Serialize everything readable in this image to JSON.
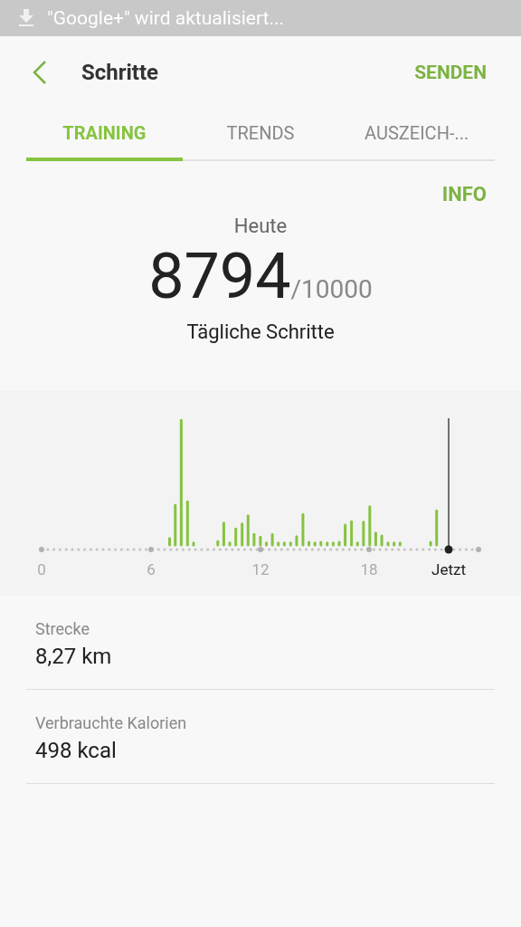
{
  "status_bar": {
    "notification": "\"Google+\" wird aktualisiert..."
  },
  "header": {
    "title": "Schritte",
    "action": "SENDEN"
  },
  "tabs": [
    {
      "label": "TRAINING",
      "selected": true
    },
    {
      "label": "TRENDS",
      "selected": false
    },
    {
      "label": "AUSZEICH-...",
      "selected": false
    }
  ],
  "info_link": "INFO",
  "summary": {
    "day_label": "Heute",
    "steps": "8794",
    "goal": "/10000",
    "caption": "Tägliche Schritte"
  },
  "chart": {
    "axis_labels": [
      "0",
      "6",
      "12",
      "18"
    ],
    "now_label": "Jetzt"
  },
  "stats": [
    {
      "label": "Strecke",
      "value": "8,27 km"
    },
    {
      "label": "Verbrauchte Kalorien",
      "value": "498 kcal"
    }
  ]
}
